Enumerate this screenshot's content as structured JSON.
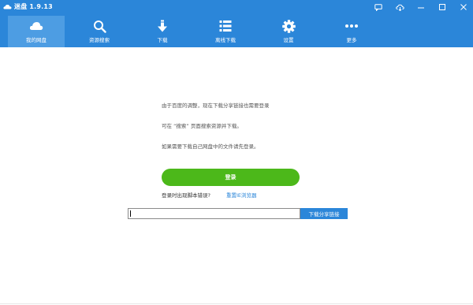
{
  "app": {
    "title": "迷盘 1.9.13"
  },
  "nav": {
    "items": [
      {
        "label": "我的网盘",
        "icon": "cloud-icon"
      },
      {
        "label": "资源搜索",
        "icon": "search-icon"
      },
      {
        "label": "下载",
        "icon": "download-icon"
      },
      {
        "label": "离线下载",
        "icon": "list-icon"
      },
      {
        "label": "设置",
        "icon": "gear-icon"
      },
      {
        "label": "更多",
        "icon": "more-dots-icon"
      }
    ]
  },
  "main": {
    "messages": [
      "由于百度的调整，现在下载分享链接也需要登录",
      "可在 “搜索” 页面搜索资源并下载。",
      "如果需要下载自己网盘中的文件请先登录。"
    ],
    "login_label": "登录",
    "login_error_question": "登录时出现脚本错误?",
    "reset_ie_label": "重置IE浏览器",
    "share_input_value": "",
    "share_button_label": "下载分享链接"
  },
  "colors": {
    "brand": "#2b86d9",
    "nav_active": "#4d9de3",
    "login": "#4cb81a"
  }
}
